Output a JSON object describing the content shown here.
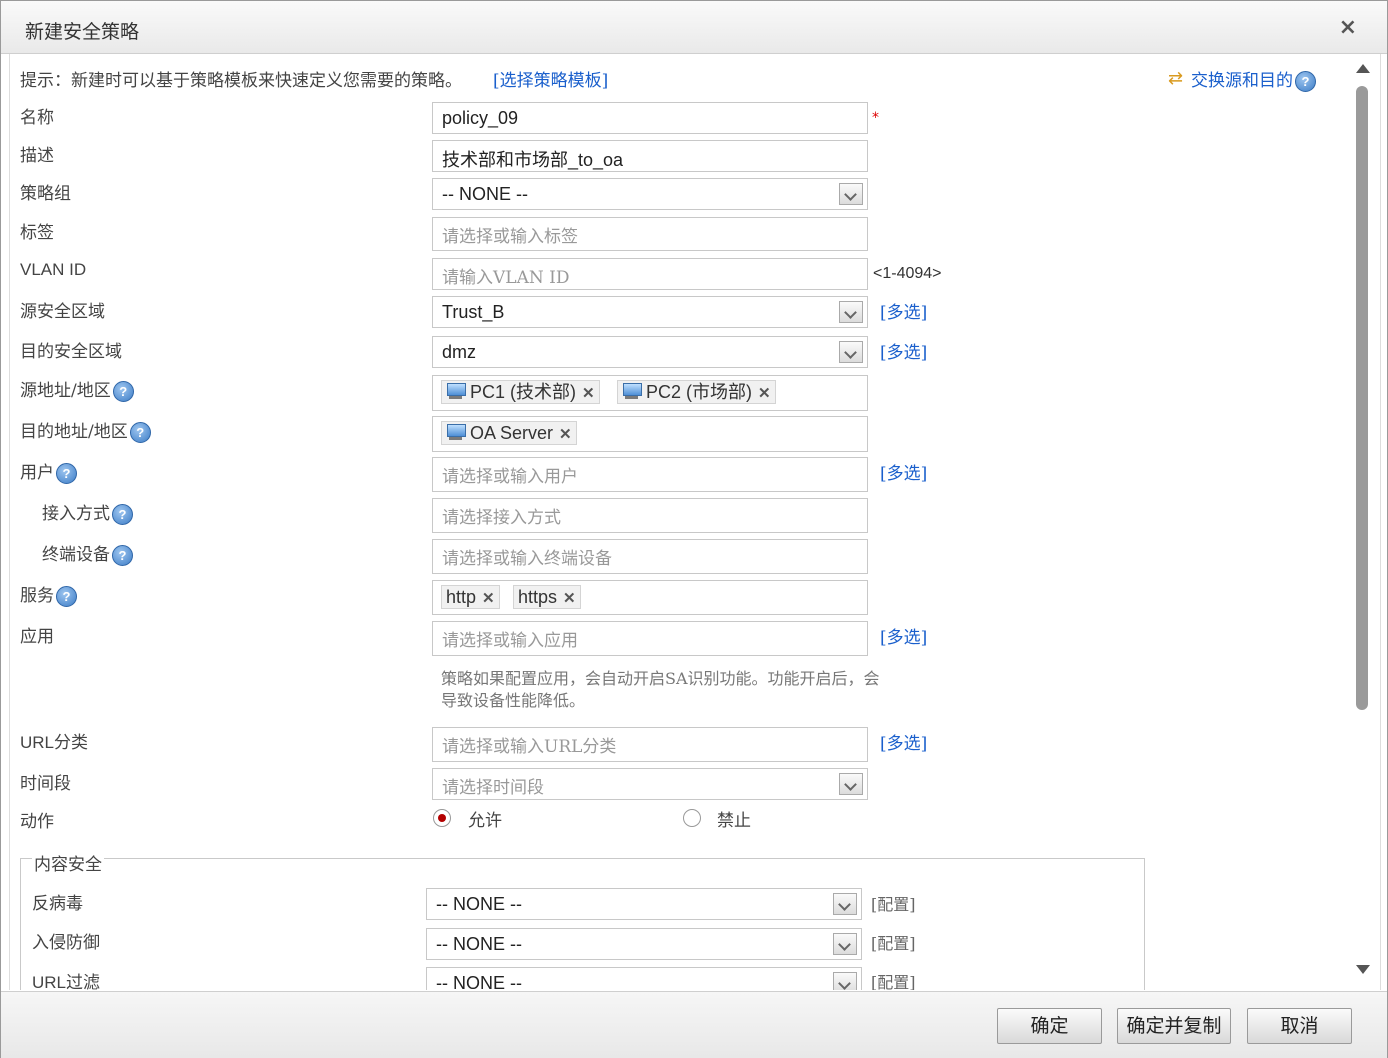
{
  "dialog": {
    "title": "新建安全策略",
    "close_icon": "×"
  },
  "hint": {
    "text": "提示：新建时可以基于策略模板来快速定义您需要的策略。",
    "template_link": "[选择策略模板]",
    "swap_link": "交换源和目的"
  },
  "form": {
    "name": {
      "label": "名称",
      "value": "policy_09",
      "required": "*"
    },
    "description": {
      "label": "描述",
      "value": "技术部和市场部_to_oa"
    },
    "policy_group": {
      "label": "策略组",
      "value": "-- NONE --"
    },
    "tag": {
      "label": "标签",
      "placeholder": "请选择或输入标签"
    },
    "vlan": {
      "label": "VLAN ID",
      "placeholder": "请输入VLAN ID",
      "range": "<1-4094>"
    },
    "src_zone": {
      "label": "源安全区域",
      "value": "Trust_B",
      "multi": "[多选]"
    },
    "dst_zone": {
      "label": "目的安全区域",
      "value": "dmz",
      "multi": "[多选]"
    },
    "src_addr": {
      "label": "源地址/地区",
      "tags": [
        "PC1 (技术部)",
        "PC2 (市场部)"
      ]
    },
    "dst_addr": {
      "label": "目的地址/地区",
      "tags": [
        "OA Server"
      ]
    },
    "user": {
      "label": "用户",
      "placeholder": "请选择或输入用户",
      "multi": "[多选]"
    },
    "access": {
      "label": "接入方式",
      "placeholder": "请选择接入方式"
    },
    "device": {
      "label": "终端设备",
      "placeholder": "请选择或输入终端设备"
    },
    "service": {
      "label": "服务",
      "tags": [
        "http",
        "https"
      ]
    },
    "app": {
      "label": "应用",
      "placeholder": "请选择或输入应用",
      "multi": "[多选]",
      "note": "策略如果配置应用，会自动开启SA识别功能。功能开启后，会导致设备性能降低。"
    },
    "url": {
      "label": "URL分类",
      "placeholder": "请选择或输入URL分类",
      "multi": "[多选]"
    },
    "time": {
      "label": "时间段",
      "placeholder": "请选择时间段"
    },
    "action": {
      "label": "动作",
      "allow": "允许",
      "deny": "禁止",
      "selected": "允许"
    }
  },
  "content_security": {
    "legend": "内容安全",
    "antivirus": {
      "label": "反病毒",
      "value": "-- NONE --",
      "config": "[配置]"
    },
    "ips": {
      "label": "入侵防御",
      "value": "-- NONE --",
      "config": "[配置]"
    },
    "url_filter": {
      "label": "URL过滤",
      "value": "-- NONE --",
      "config": "[配置]"
    }
  },
  "footer": {
    "ok": "确定",
    "ok_copy": "确定并复制",
    "cancel": "取消"
  },
  "help_icon": "?",
  "tag_remove_icon": "✕"
}
